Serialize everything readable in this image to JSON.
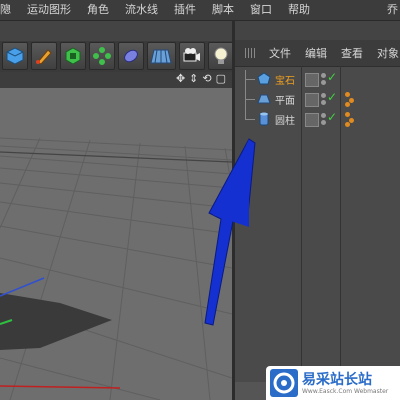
{
  "menubar": {
    "items": [
      "䧭",
      "运动图形",
      "角色",
      "流水线",
      "插件",
      "脚本",
      "窗口",
      "帮助"
    ],
    "last_item": "乔"
  },
  "toolbar": {
    "icons": [
      "cube-icon",
      "pen-icon",
      "subdivide-icon",
      "array-icon",
      "deformer-icon",
      "floor-icon",
      "camera-icon",
      "light-icon"
    ]
  },
  "viewport": {
    "nav_glyphs": [
      "✥",
      "⇕",
      "⟲",
      "▢"
    ]
  },
  "object_manager": {
    "menu": [
      "文件",
      "编辑",
      "查看",
      "对象"
    ],
    "objects": [
      {
        "name": "宝石",
        "icon": "gem-icon",
        "selected": true
      },
      {
        "name": "平面",
        "icon": "plane-icon",
        "selected": false
      },
      {
        "name": "圆柱",
        "icon": "cylinder-icon",
        "selected": false
      }
    ]
  },
  "watermark": {
    "title": "易采站长站",
    "subtitle": "Www.Easck.Com Webmaster"
  },
  "colors": {
    "selected_object": "#f0a020",
    "check": "#40d040",
    "annotation_arrow": "#1530d0"
  }
}
